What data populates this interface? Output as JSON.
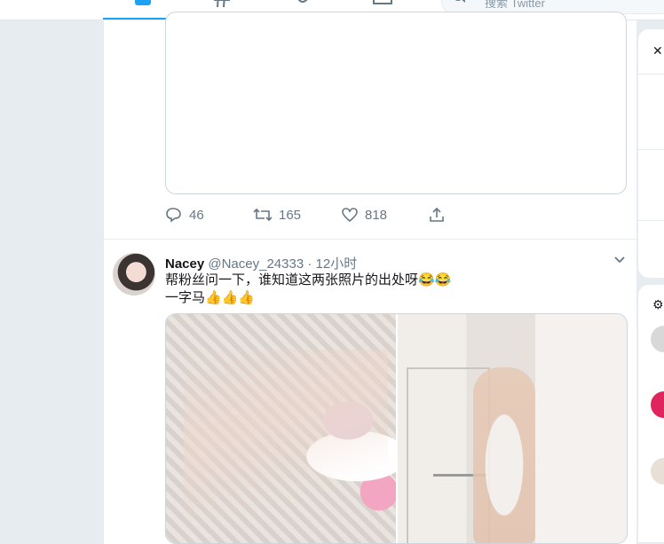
{
  "nav": {
    "search_placeholder": "搜索 Twitter",
    "accent": "#1da1f2"
  },
  "previous_tweet": {
    "actions": {
      "reply_count": "46",
      "retweet_count": "165",
      "like_count": "818"
    }
  },
  "tweet": {
    "name": "Nacey",
    "handle": "@Nacey_24333",
    "separator": "·",
    "time": "12小时",
    "text_line1": "帮粉丝问一下，谁知道这两张照片的出处呀😂😂",
    "text_line2": "一字马👍👍👍",
    "photos": [
      "photo-left",
      "photo-right"
    ]
  },
  "icons": [
    "home-icon",
    "hashtag-icon",
    "bell-icon",
    "mail-icon",
    "search-icon",
    "reply-icon",
    "retweet-icon",
    "like-icon",
    "share-icon",
    "chevron-down-icon"
  ],
  "colors": {
    "background": "#e6ecf0",
    "text_secondary": "#657786",
    "border": "#ccd6dd"
  }
}
